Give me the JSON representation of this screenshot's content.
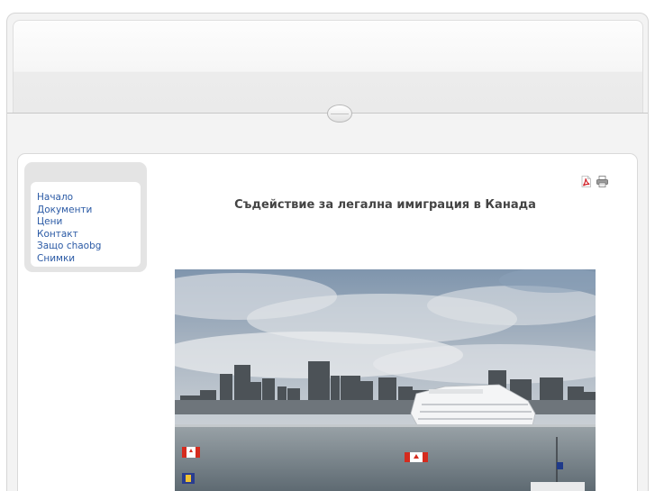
{
  "menu": {
    "items": [
      {
        "label": "Начало"
      },
      {
        "label": "Документи"
      },
      {
        "label": "Цени"
      },
      {
        "label": "Контакт"
      },
      {
        "label": "Защо chaobg"
      },
      {
        "label": "Снимки"
      }
    ]
  },
  "toolbar": {
    "pdf_icon": "pdf-icon",
    "print_icon": "print-icon"
  },
  "article": {
    "title": "Съдействие за легална имиграция в Канада"
  },
  "colors": {
    "link": "#2b5aa5",
    "title": "#444444",
    "frame": "#e4e4e4"
  }
}
